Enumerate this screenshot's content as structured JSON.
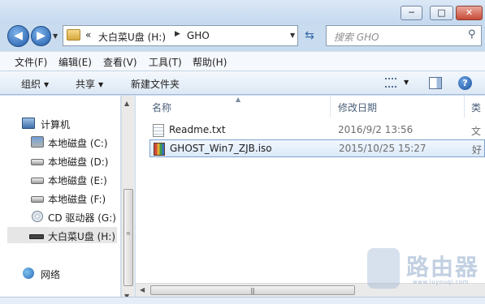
{
  "window": {
    "controls": {
      "minimize": "─",
      "maximize": "□",
      "close": "✕"
    }
  },
  "navigation": {
    "back_glyph": "◀",
    "forward_glyph": "▶",
    "address": {
      "prefix": "«",
      "segments": [
        "大白菜U盘 (H:)",
        "GHO"
      ],
      "separator": "▶"
    },
    "search_placeholder": "搜索 GHO"
  },
  "menu": [
    "文件(F)",
    "编辑(E)",
    "查看(V)",
    "工具(T)",
    "帮助(H)"
  ],
  "toolbar": {
    "organize": "组织",
    "share": "共享",
    "new_folder": "新建文件夹",
    "help_glyph": "?"
  },
  "nav_pane": {
    "computer": "计算机",
    "drives": [
      {
        "label": "本地磁盘 (C:)",
        "icon": "system-drive-icon"
      },
      {
        "label": "本地磁盘 (D:)",
        "icon": "hard-drive-icon"
      },
      {
        "label": "本地磁盘 (E:)",
        "icon": "hard-drive-icon"
      },
      {
        "label": "本地磁盘 (F:)",
        "icon": "hard-drive-icon"
      },
      {
        "label": "CD 驱动器 (G:)",
        "icon": "cd-drive-icon"
      },
      {
        "label": "大白菜U盘 (H:)",
        "icon": "usb-drive-icon",
        "selected": true
      }
    ],
    "network": "网络"
  },
  "columns": {
    "name": "名称",
    "date_modified": "修改日期",
    "type": "类"
  },
  "files": [
    {
      "name": "Readme.txt",
      "date": "2016/9/2 13:56",
      "type": "文",
      "icon": "text-file-icon"
    },
    {
      "name": "GHOST_Win7_ZJB.iso",
      "date": "2015/10/25 15:27",
      "type": "好",
      "icon": "iso-file-icon",
      "selected": true
    }
  ],
  "watermark": {
    "text": "路由器",
    "sub": "www.luyouqi.com"
  }
}
